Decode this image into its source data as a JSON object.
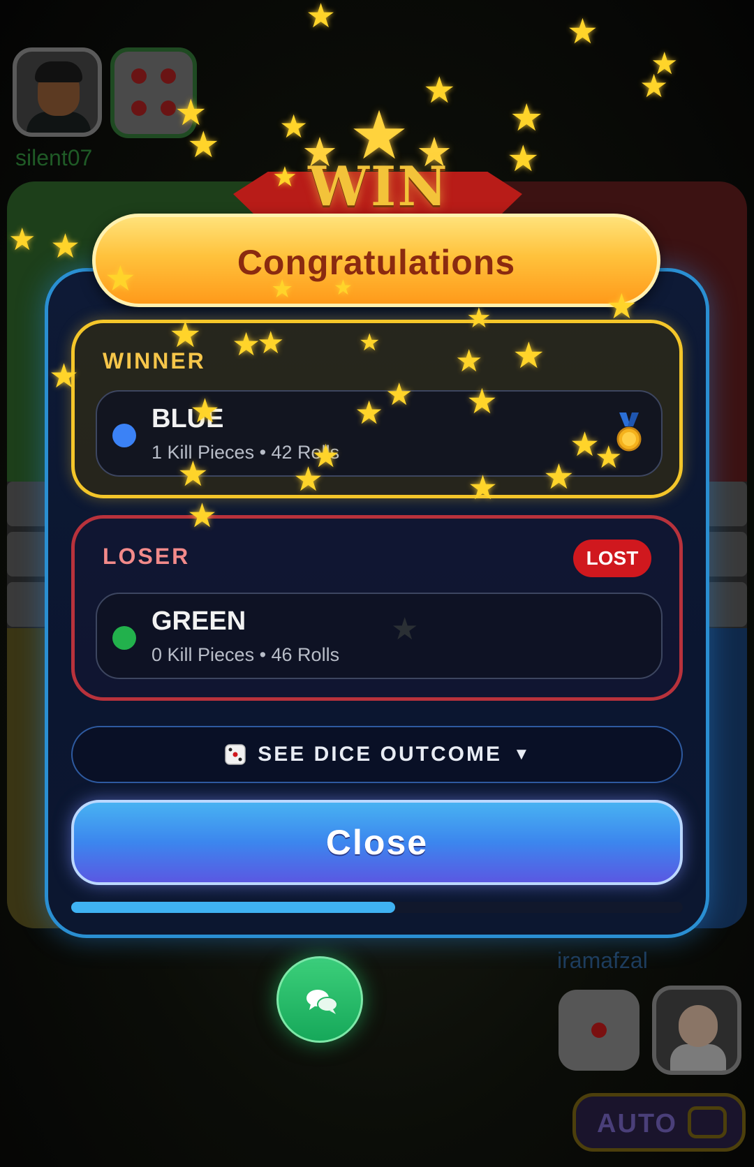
{
  "players": {
    "top_left": {
      "name": "silent07",
      "dice_face": 4
    },
    "bottom_right": {
      "name": "iramafzal",
      "dice_face": 1
    }
  },
  "result_dialog": {
    "badge_text": "WIN",
    "title": "Congratulations",
    "winner": {
      "section_label": "WINNER",
      "name": "BLUE",
      "stats": "1 Kill Pieces • 42 Rolls",
      "color": "#3b82f6",
      "icon": "gold-medal-icon"
    },
    "loser": {
      "section_label": "LOSER",
      "badge": "LOST",
      "name": "GREEN",
      "stats": "0 Kill Pieces • 46 Rolls",
      "color": "#22b14c"
    },
    "dice_outcome_label": "SEE DICE OUTCOME",
    "dice_outcome_icon": "dice-icon",
    "close_label": "Close",
    "progress": 0.53
  },
  "auto_toggle": {
    "label": "AUTO",
    "enabled": false
  },
  "chat_button_icon": "chat-bubbles-icon",
  "theme": {
    "accent_blue": "#2a8fd2",
    "winner_gold": "#f4c62a",
    "loser_red": "#b8323c",
    "lost_badge": "#d0181e"
  }
}
